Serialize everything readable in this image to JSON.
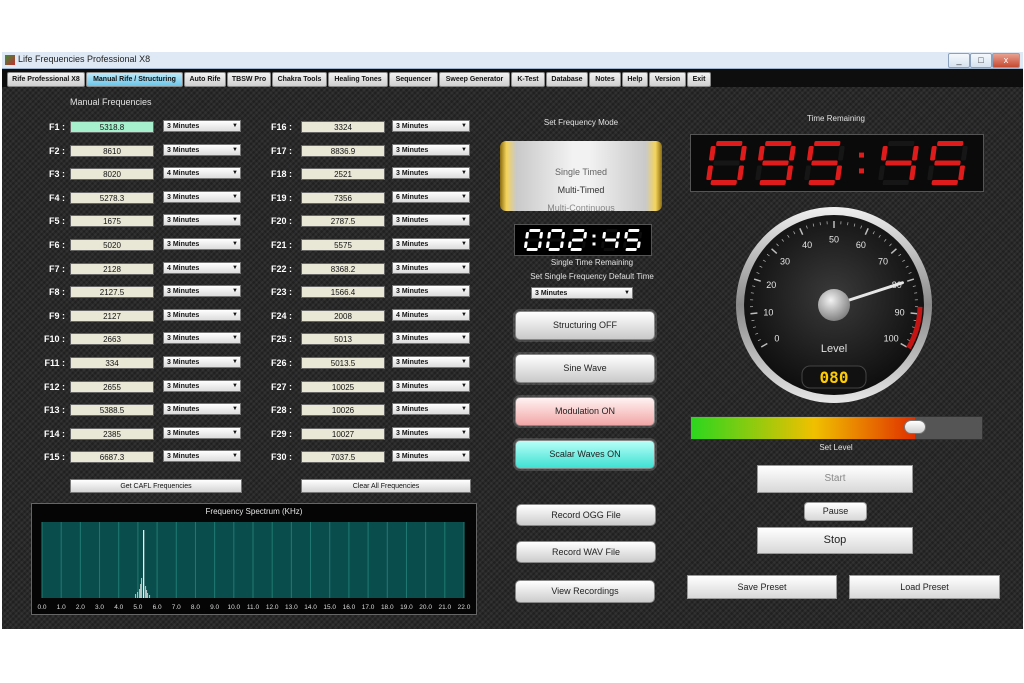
{
  "window": {
    "title": "Life Frequencies Professional X8",
    "controls": [
      "_",
      "□",
      "x"
    ]
  },
  "tabs": [
    {
      "label": "Rife Professional X8",
      "active": false
    },
    {
      "label": "Manual Rife / Structuring",
      "active": true
    },
    {
      "label": "Auto Rife",
      "active": false
    },
    {
      "label": "TBSW Pro",
      "active": false
    },
    {
      "label": "Chakra Tools",
      "active": false
    },
    {
      "label": "Healing Tones",
      "active": false
    },
    {
      "label": "Sequencer",
      "active": false
    },
    {
      "label": "Sweep Generator",
      "active": false
    },
    {
      "label": "K-Test",
      "active": false
    },
    {
      "label": "Database",
      "active": false
    },
    {
      "label": "Notes",
      "active": false
    },
    {
      "label": "Help",
      "active": false
    },
    {
      "label": "Version",
      "active": false
    },
    {
      "label": "Exit",
      "active": false
    }
  ],
  "manual": {
    "title": "Manual Frequencies",
    "frequencies": [
      {
        "label": "F1 :",
        "value": "5318.8",
        "duration": "3 Minutes"
      },
      {
        "label": "F2 :",
        "value": "8610",
        "duration": "3 Minutes"
      },
      {
        "label": "F3 :",
        "value": "8020",
        "duration": "4 Minutes"
      },
      {
        "label": "F4 :",
        "value": "5278.3",
        "duration": "3 Minutes"
      },
      {
        "label": "F5 :",
        "value": "1675",
        "duration": "3 Minutes"
      },
      {
        "label": "F6 :",
        "value": "5020",
        "duration": "3 Minutes"
      },
      {
        "label": "F7 :",
        "value": "2128",
        "duration": "4 Minutes"
      },
      {
        "label": "F8 :",
        "value": "2127.5",
        "duration": "3 Minutes"
      },
      {
        "label": "F9 :",
        "value": "2127",
        "duration": "3 Minutes"
      },
      {
        "label": "F10 :",
        "value": "2663",
        "duration": "3 Minutes"
      },
      {
        "label": "F11 :",
        "value": "334",
        "duration": "3 Minutes"
      },
      {
        "label": "F12 :",
        "value": "2655",
        "duration": "3 Minutes"
      },
      {
        "label": "F13 :",
        "value": "5388.5",
        "duration": "3 Minutes"
      },
      {
        "label": "F14 :",
        "value": "2385",
        "duration": "3 Minutes"
      },
      {
        "label": "F15 :",
        "value": "6687.3",
        "duration": "3 Minutes"
      },
      {
        "label": "F16 :",
        "value": "3324",
        "duration": "3 Minutes"
      },
      {
        "label": "F17 :",
        "value": "8836.9",
        "duration": "3 Minutes"
      },
      {
        "label": "F18 :",
        "value": "2521",
        "duration": "3 Minutes"
      },
      {
        "label": "F19 :",
        "value": "7356",
        "duration": "6 Minutes"
      },
      {
        "label": "F20 :",
        "value": "2787.5",
        "duration": "3 Minutes"
      },
      {
        "label": "F21 :",
        "value": "5575",
        "duration": "3 Minutes"
      },
      {
        "label": "F22 :",
        "value": "8368.2",
        "duration": "3 Minutes"
      },
      {
        "label": "F23 :",
        "value": "1566.4",
        "duration": "3 Minutes"
      },
      {
        "label": "F24 :",
        "value": "2008",
        "duration": "4 Minutes"
      },
      {
        "label": "F25 :",
        "value": "5013",
        "duration": "3 Minutes"
      },
      {
        "label": "F26 :",
        "value": "5013.5",
        "duration": "3 Minutes"
      },
      {
        "label": "F27 :",
        "value": "10025",
        "duration": "3 Minutes"
      },
      {
        "label": "F28 :",
        "value": "10026",
        "duration": "3 Minutes"
      },
      {
        "label": "F29 :",
        "value": "10027",
        "duration": "3 Minutes"
      },
      {
        "label": "F30 :",
        "value": "7037.5",
        "duration": "3 Minutes"
      }
    ],
    "get_cafl_label": "Get CAFL Frequencies",
    "clear_all_label": "Clear All Frequencies"
  },
  "spectrum": {
    "title": "Frequency Spectrum (KHz)",
    "ticks": [
      "0.0",
      "1.0",
      "2.0",
      "3.0",
      "4.0",
      "5.0",
      "6.0",
      "7.0",
      "8.0",
      "9.0",
      "10.0",
      "11.0",
      "12.0",
      "13.0",
      "14.0",
      "15.0",
      "16.0",
      "17.0",
      "18.0",
      "19.0",
      "20.0",
      "21.0",
      "22.0"
    ],
    "peak_khz": 5.3,
    "bg_color": "#0a4d4d",
    "grid_color": "#1f7a73"
  },
  "mode": {
    "title": "Set Frequency Mode",
    "options": [
      "Single Timed",
      "Multi-Timed",
      "Multi-Continuous"
    ],
    "selected": "Multi-Timed"
  },
  "single_timer": {
    "display": "00:2:45",
    "caption": "Single Time Remaining",
    "default_time_label": "Set Single Frequency Default Time",
    "default_time_value": "3 Minutes",
    "digit_color": "#ffffff"
  },
  "controls": {
    "structuring": "Structuring OFF",
    "sine_wave": "Sine Wave",
    "modulation": "Modulation ON",
    "scalar": "Scalar Waves ON",
    "record_ogg": "Record OGG File",
    "record_wav": "Record WAV File",
    "view_recordings": "View Recordings"
  },
  "time_remaining": {
    "title": "Time Remaining",
    "display": "095:45",
    "digit_color": "#e01b1b"
  },
  "gauge": {
    "ticks": [
      "0",
      "10",
      "20",
      "30",
      "40",
      "50",
      "60",
      "70",
      "80",
      "90",
      "100"
    ],
    "label": "Level",
    "readout": "080",
    "value": 80,
    "readout_color": "#ffcc00"
  },
  "level": {
    "label": "Set Level",
    "value": 0.77
  },
  "playback": {
    "start": "Start",
    "pause": "Pause",
    "stop": "Stop",
    "save_preset": "Save Preset",
    "load_preset": "Load Preset"
  }
}
